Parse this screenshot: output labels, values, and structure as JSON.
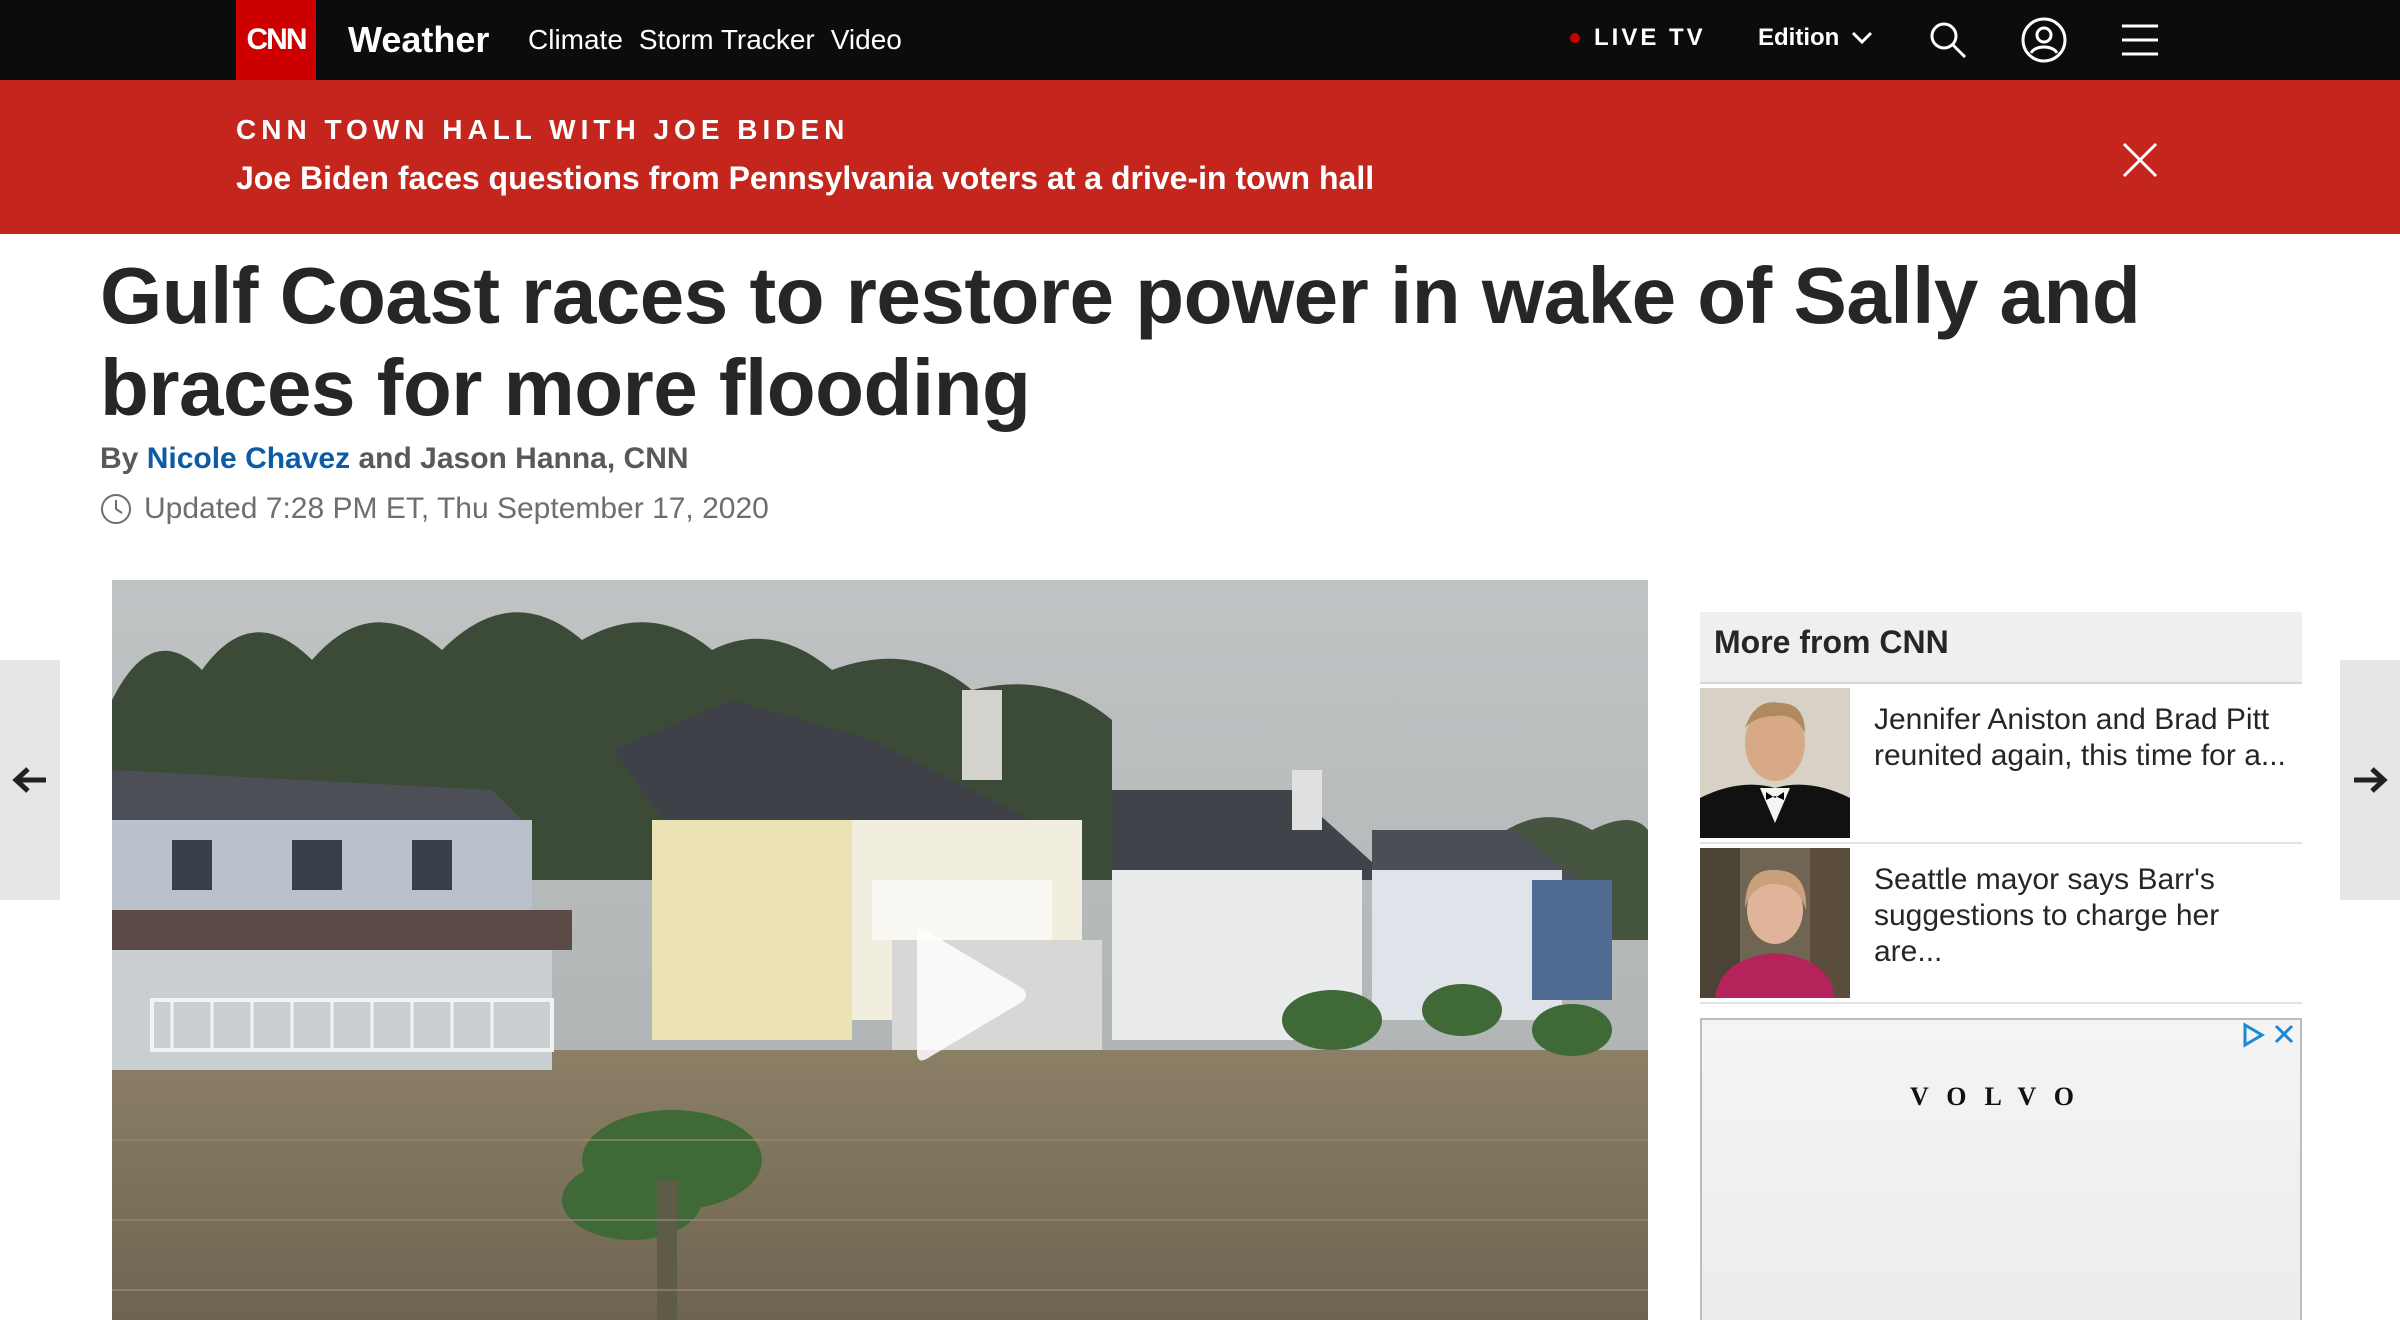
{
  "nav": {
    "logo": "CNN",
    "section": "Weather",
    "links": [
      "Climate",
      "Storm Tracker",
      "Video"
    ],
    "live_tv": "LIVE TV",
    "edition": "Edition"
  },
  "banner": {
    "kicker": "CNN TOWN HALL WITH JOE BIDEN",
    "headline": "Joe Biden faces questions from Pennsylvania voters at a drive-in town hall"
  },
  "article": {
    "title": "Gulf Coast races to restore power in wake of Sally and braces for more flooding",
    "byline_prefix": "By",
    "author": "Nicole Chavez",
    "byline_suffix": "and Jason Hanna, CNN",
    "updated": "Updated 7:28 PM ET, Thu September 17, 2020"
  },
  "more_from_cnn": {
    "header": "More from CNN",
    "items": [
      {
        "text": "Jennifer Aniston and Brad Pitt reunited again, this time for a..."
      },
      {
        "text": "Seattle mayor says Barr's suggestions to charge her are..."
      }
    ]
  },
  "ad": {
    "brand": "VOLVO"
  },
  "colors": {
    "nav_bg": "#0c0c0c",
    "brand_red": "#cc0000",
    "banner_red": "#c4261d",
    "author_link": "#0c5ca5"
  }
}
